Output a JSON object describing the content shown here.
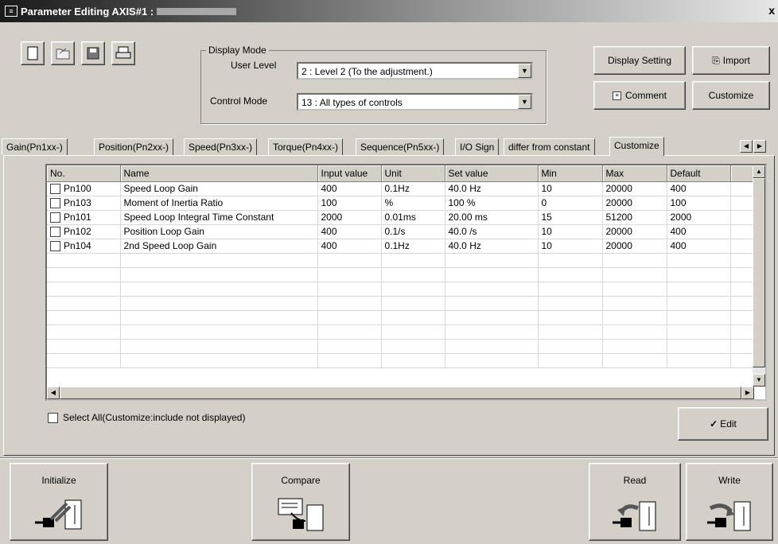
{
  "window": {
    "title": "Parameter Editing AXIS#1 : ",
    "close": "x"
  },
  "display_mode": {
    "legend": "Display Mode",
    "user_level_label": "User Level",
    "user_level_value": "2 : Level 2 (To the adjustment.)",
    "control_mode_label": "Control Mode",
    "control_mode_value": "13 : All types of controls"
  },
  "buttons": {
    "display_setting": "Display Setting",
    "import": "Import",
    "comment": "Comment",
    "customize": "Customize",
    "edit": "Edit",
    "initialize": "Initialize",
    "compare": "Compare",
    "read": "Read",
    "write": "Write"
  },
  "tabs": [
    "Gain(Pn1xx-)",
    "Position(Pn2xx-)",
    "Speed(Pn3xx-)",
    "Torque(Pn4xx-)",
    "Sequence(Pn5xx-)",
    "I/O Sign",
    "differ from constant",
    "Customize"
  ],
  "table": {
    "columns": [
      "No.",
      "Name",
      "Input value",
      "Unit",
      "Set value",
      "Min",
      "Max",
      "Default"
    ],
    "rows": [
      [
        "Pn100",
        "Speed Loop Gain",
        "400",
        "0.1Hz",
        "40.0 Hz",
        "10",
        "20000",
        "400"
      ],
      [
        "Pn103",
        "Moment of Inertia Ratio",
        "100",
        "%",
        "100 %",
        "0",
        "20000",
        "100"
      ],
      [
        "Pn101",
        "Speed Loop Integral Time Constant",
        "2000",
        "0.01ms",
        "20.00 ms",
        "15",
        "51200",
        "2000"
      ],
      [
        "Pn102",
        "Position Loop Gain",
        "400",
        "0.1/s",
        "40.0 /s",
        "10",
        "20000",
        "400"
      ],
      [
        "Pn104",
        "2nd Speed Loop Gain",
        "400",
        "0.1Hz",
        "40.0 Hz",
        "10",
        "20000",
        "400"
      ]
    ]
  },
  "select_all_label": "Select All(Customize:include not displayed)"
}
